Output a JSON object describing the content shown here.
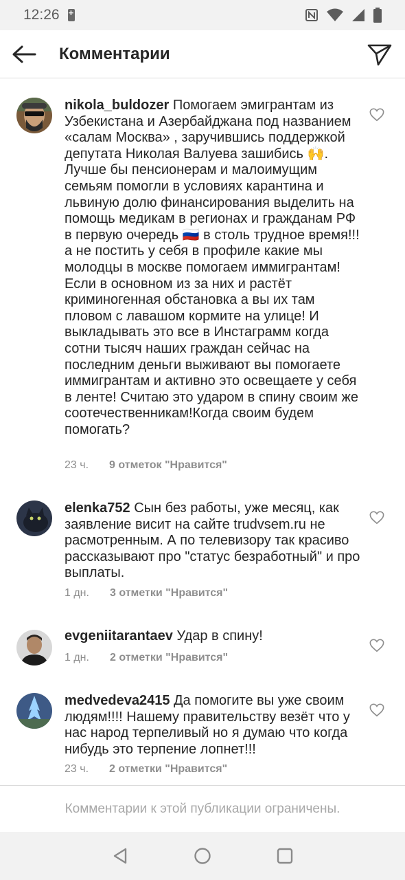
{
  "status_bar": {
    "time": "12:26"
  },
  "header": {
    "title": "Комментарии"
  },
  "comments": [
    {
      "username": "nikola_buldozer",
      "text": "Помогаем эмигрантам из Узбекистана и Азербайджана под названием «салам Москва» , заручившись поддержкой депутата Николая Валуева зашибись 🙌. Лучше бы пенсионерам и малоимущим семьям помогли в условиях карантина и львиную долю финансирования выделить на помощь медикам в регионах и гражданам РФ в первую очередь 🇷🇺 в столь трудное время!!! а не постить у себя в профиле какие мы молодцы в москве помогаем иммигрантам! Если в основном из за них и растёт криминогенная обстановка а вы их там пловом с лавашом кормите на улице! И выкладывать это все в Инстаграмм когда сотни тысяч наших граждан сейчас на последним деньги выживают вы помогаете иммигрантам и активно это освещаете у себя в ленте! Считаю это ударом в спину своим же соотечественникам!Когда своим будем помогать?",
      "time": "23 ч.",
      "likes": "9 отметок \"Нравится\""
    },
    {
      "username": "elenka752",
      "text": "Сын без работы, уже месяц, как заявление висит на сайте trudvsem.ru не расмотренным. А по телевизору так красиво рассказывают про \"статус безработный\" и про выплаты.",
      "time": "1 дн.",
      "likes": "3 отметки \"Нравится\""
    },
    {
      "username": "evgeniitarantaev",
      "text": "Удар в спину!",
      "time": "1 дн.",
      "likes": "2 отметки \"Нравится\""
    },
    {
      "username": "medvedeva2415",
      "text": "Да помогите вы уже своим людям!!!! Нашему правительству везёт что у нас народ терпеливый но я думаю что когда нибудь это терпение лопнет!!!",
      "time": "23 ч.",
      "likes": "2 отметки \"Нравится\""
    }
  ],
  "footer": {
    "restricted_text": "Комментарии к этой публикации ограничены."
  },
  "icons": {
    "back": "arrow-left-icon",
    "share": "paper-plane-icon",
    "like": "heart-outline-icon",
    "nav_back": "triangle-back-icon",
    "nav_home": "circle-home-icon",
    "nav_recents": "square-recents-icon"
  },
  "colors": {
    "text": "#262626",
    "secondary": "#8e8e8e",
    "divider": "#dbdbdb"
  }
}
